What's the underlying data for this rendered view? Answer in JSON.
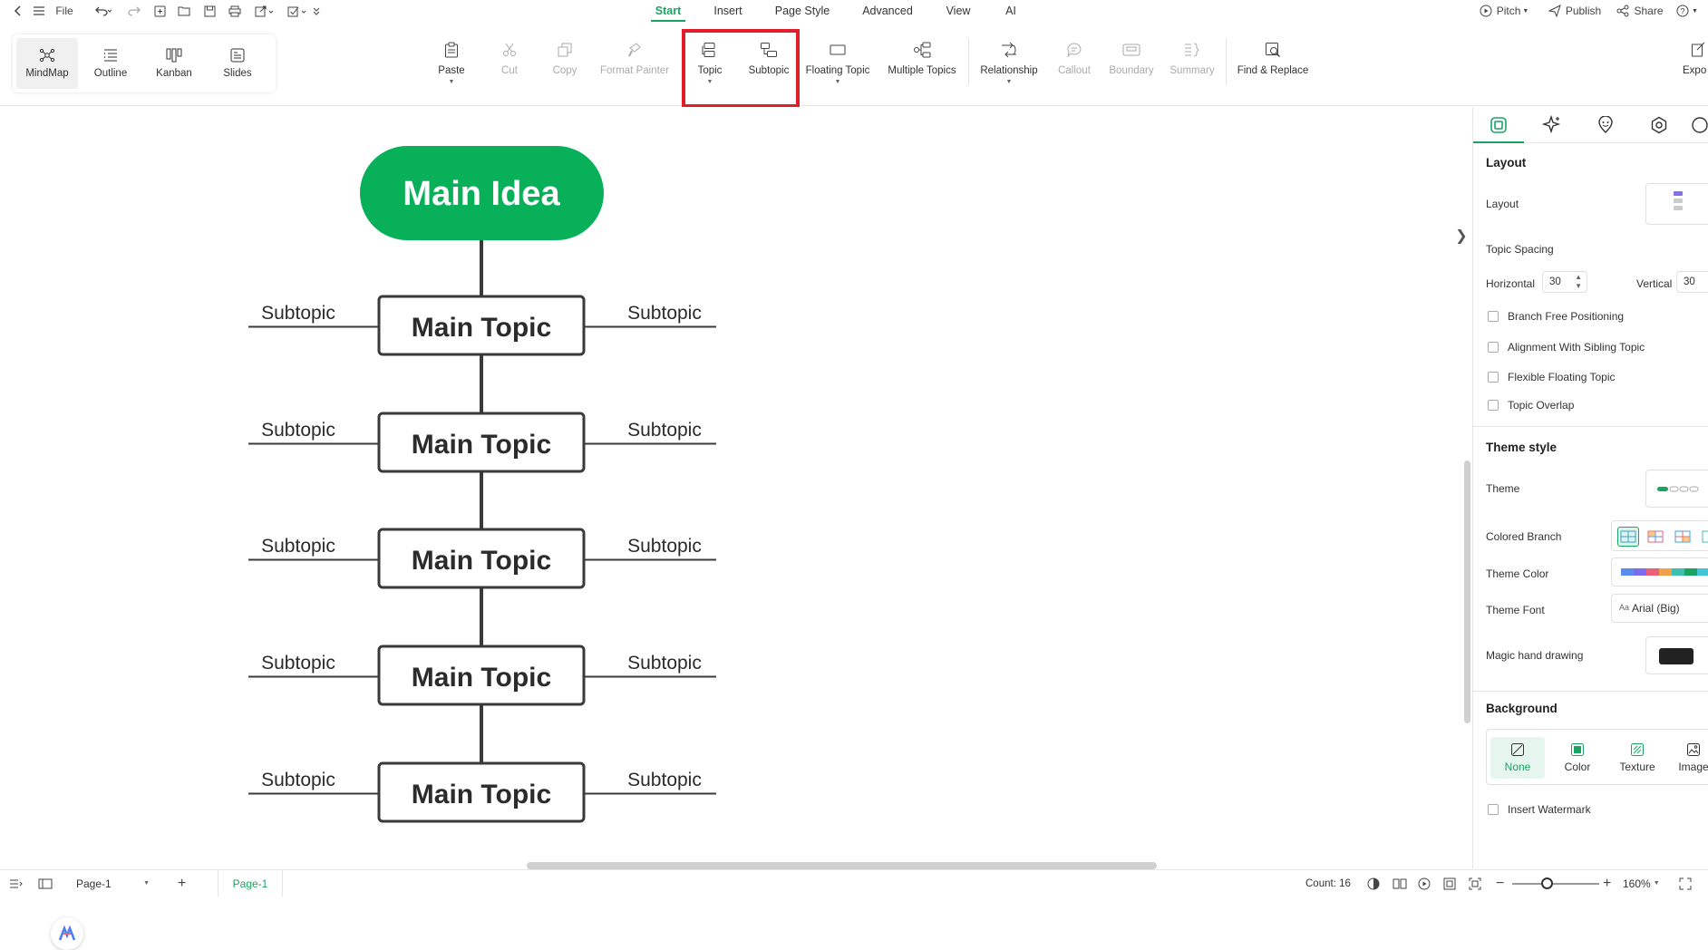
{
  "menubar": {
    "file_label": "File",
    "tabs": [
      {
        "label": "Start",
        "active": true
      },
      {
        "label": "Insert"
      },
      {
        "label": "Page Style"
      },
      {
        "label": "Advanced"
      },
      {
        "label": "View"
      },
      {
        "label": "AI"
      }
    ],
    "pitch_label": "Pitch",
    "publish_label": "Publish",
    "share_label": "Share",
    "help_label": "?"
  },
  "toolbar": {
    "views": [
      {
        "label": "MindMap",
        "icon": "mindmap-icon",
        "active": true
      },
      {
        "label": "Outline",
        "icon": "outline-icon"
      },
      {
        "label": "Kanban",
        "icon": "kanban-icon"
      },
      {
        "label": "Slides",
        "icon": "slides-icon"
      }
    ],
    "buttons": {
      "paste": "Paste",
      "cut": "Cut",
      "copy": "Copy",
      "format_painter": "Format Painter",
      "topic": "Topic",
      "subtopic": "Subtopic",
      "floating_topic": "Floating Topic",
      "multiple_topics": "Multiple Topics",
      "relationship": "Relationship",
      "callout": "Callout",
      "boundary": "Boundary",
      "summary": "Summary",
      "find_replace": "Find & Replace",
      "export": "Expo"
    }
  },
  "mindmap": {
    "main_idea": "Main Idea",
    "main_idea_color": "#08b05a",
    "rows": [
      {
        "topic": "Main Topic",
        "left_subtopic": "Subtopic",
        "right_subtopic": "Subtopic"
      },
      {
        "topic": "Main Topic",
        "left_subtopic": "Subtopic",
        "right_subtopic": "Subtopic"
      },
      {
        "topic": "Main Topic",
        "left_subtopic": "Subtopic",
        "right_subtopic": "Subtopic"
      },
      {
        "topic": "Main Topic",
        "left_subtopic": "Subtopic",
        "right_subtopic": "Subtopic"
      },
      {
        "topic": "Main Topic",
        "left_subtopic": "Subtopic",
        "right_subtopic": "Subtopic"
      }
    ]
  },
  "panel": {
    "layout_heading": "Layout",
    "layout_label": "Layout",
    "topic_spacing_label": "Topic Spacing",
    "horizontal_label": "Horizontal",
    "horizontal_value": "30",
    "vertical_label": "Vertical",
    "vertical_value": "30",
    "checkboxes": [
      "Branch Free Positioning",
      "Alignment With Sibling Topic",
      "Flexible Floating Topic",
      "Topic Overlap"
    ],
    "theme_style_heading": "Theme style",
    "theme_label": "Theme",
    "colored_branch_label": "Colored Branch",
    "theme_color_label": "Theme Color",
    "theme_font_label": "Theme Font",
    "theme_font_value": "Arial (Big)",
    "magic_hand_label": "Magic hand drawing",
    "background_heading": "Background",
    "background_options": [
      {
        "label": "None",
        "active": true
      },
      {
        "label": "Color"
      },
      {
        "label": "Texture"
      },
      {
        "label": "Image"
      }
    ],
    "insert_watermark_label": "Insert Watermark",
    "theme_colors": [
      "#5b8def",
      "#7b6cf0",
      "#e8607a",
      "#f0a04b",
      "#3cbfae",
      "#1aa463",
      "#44c4d8"
    ]
  },
  "statusbar": {
    "page_select": "Page-1",
    "page_tab": "Page-1",
    "count_label": "Count: 16",
    "zoom": "160%"
  },
  "accent_color": "#1aa463",
  "highlight_color": "#e31e2b"
}
